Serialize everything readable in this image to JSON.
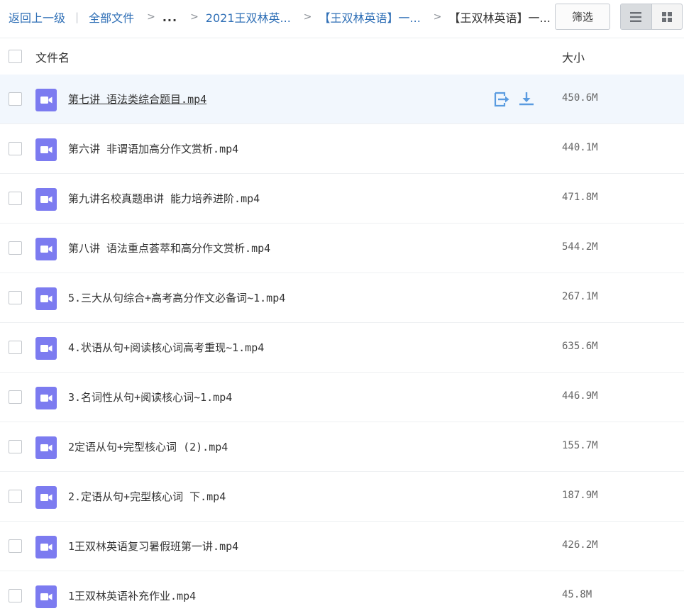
{
  "breadcrumb": {
    "back_label": "返回上一级",
    "separator": "|",
    "all_files_label": "全部文件",
    "chevron": ">",
    "ellipsis_label": "...",
    "folder_1": "2021王双林英...",
    "folder_2": "【王双林英语】一...",
    "current": "【王双林英语】一..."
  },
  "toolbar": {
    "filter_label": "筛选",
    "list_view_icon": "list-view-icon",
    "grid_view_icon": "grid-view-icon",
    "active_view": "list"
  },
  "columns": {
    "name": "文件名",
    "size": "大小"
  },
  "colors": {
    "link": "#2f6fb6",
    "video_icon": "#7c7bf0",
    "action_icon": "#5a9be0",
    "hover_row": "#f2f7fd"
  },
  "files": [
    {
      "name": "第七讲 语法类综合题目.mp4",
      "size": "450.6M",
      "icon": "video-file-icon"
    },
    {
      "name": "第六讲 非谓语加高分作文赏析.mp4",
      "size": "440.1M",
      "icon": "video-file-icon"
    },
    {
      "name": "第九讲名校真题串讲 能力培养进阶.mp4",
      "size": "471.8M",
      "icon": "video-file-icon"
    },
    {
      "name": "第八讲 语法重点荟萃和高分作文赏析.mp4",
      "size": "544.2M",
      "icon": "video-file-icon"
    },
    {
      "name": "5.三大从句综合+高考高分作文必备词~1.mp4",
      "size": "267.1M",
      "icon": "video-file-icon"
    },
    {
      "name": "4.状语从句+阅读核心词高考重现~1.mp4",
      "size": "635.6M",
      "icon": "video-file-icon"
    },
    {
      "name": "3.名词性从句+阅读核心词~1.mp4",
      "size": "446.9M",
      "icon": "video-file-icon"
    },
    {
      "name": "2定语从句+完型核心词 (2).mp4",
      "size": "155.7M",
      "icon": "video-file-icon"
    },
    {
      "name": "2.定语从句+完型核心词 下.mp4",
      "size": "187.9M",
      "icon": "video-file-icon"
    },
    {
      "name": "1王双林英语复习暑假班第一讲.mp4",
      "size": "426.2M",
      "icon": "video-file-icon"
    },
    {
      "name": "1王双林英语补充作业.mp4",
      "size": "45.8M",
      "icon": "video-file-icon"
    }
  ],
  "hovered_row_actions": {
    "move_icon": "move-to-icon",
    "download_icon": "download-icon"
  }
}
